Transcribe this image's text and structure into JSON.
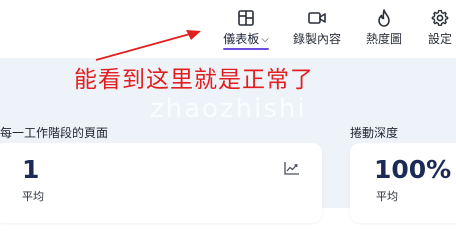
{
  "nav": {
    "items": [
      {
        "label": "儀表板",
        "icon": "dashboard-icon",
        "active": true,
        "dropdown": true
      },
      {
        "label": "錄製內容",
        "icon": "video-icon",
        "active": false
      },
      {
        "label": "熱度圖",
        "icon": "flame-icon",
        "active": false
      },
      {
        "label": "設定",
        "icon": "gear-icon",
        "active": false
      }
    ],
    "chevron": "⌵"
  },
  "annotation": {
    "text": "能看到这里就是正常了",
    "color": "#e02020"
  },
  "watermark": "zhaozhishi",
  "sections": [
    {
      "title": "每一工作階段的頁面",
      "value": "1",
      "sub": "平均",
      "icon": "trend-chart-icon"
    },
    {
      "title": "捲動深度",
      "value": "100%",
      "sub": "平均"
    }
  ],
  "colors": {
    "accent": "#6b4ee0",
    "background": "#eef3fa",
    "metric": "#1b2b55"
  }
}
